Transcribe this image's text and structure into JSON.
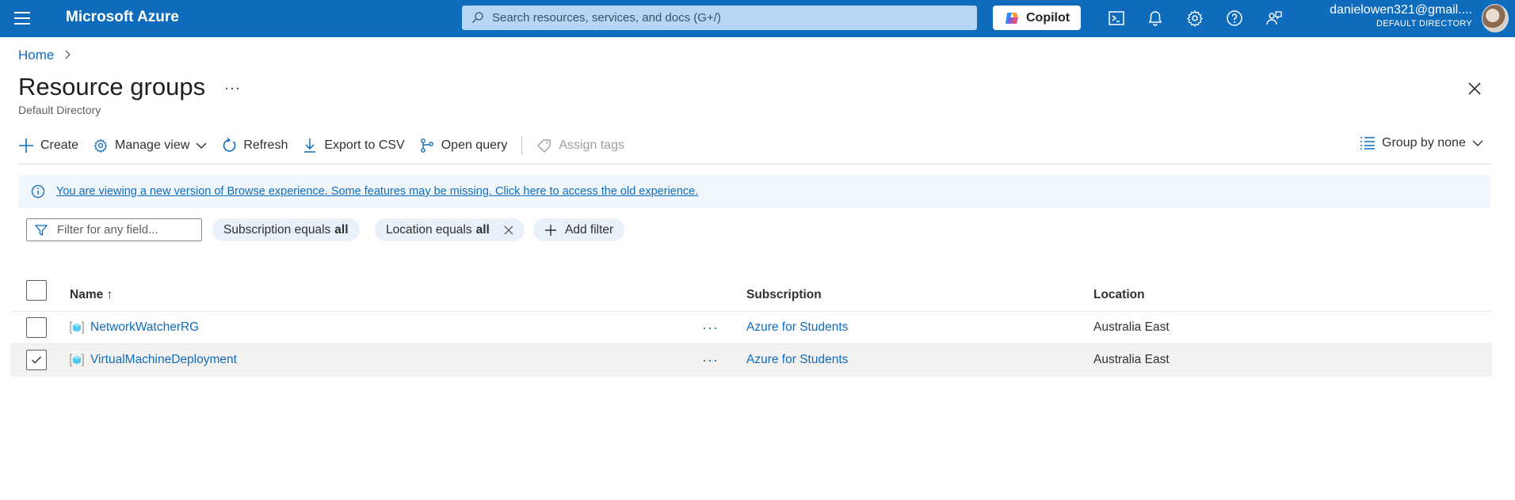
{
  "topbar": {
    "brand": "Microsoft Azure",
    "search_placeholder": "Search resources, services, and docs (G+/)",
    "copilot_label": "Copilot",
    "account_email": "danielowen321@gmail....",
    "account_directory": "DEFAULT DIRECTORY",
    "icons": [
      "cloud-shell-icon",
      "bell-icon",
      "gear-icon",
      "help-icon",
      "feedback-icon"
    ]
  },
  "breadcrumb": {
    "home": "Home"
  },
  "page": {
    "title": "Resource groups",
    "more": "···",
    "subtitle": "Default Directory"
  },
  "toolbar": {
    "create": "Create",
    "manage_view": "Manage view",
    "refresh": "Refresh",
    "export_csv": "Export to CSV",
    "open_query": "Open query",
    "assign_tags": "Assign tags",
    "group_by": "Group by none"
  },
  "banner": {
    "text": "You are viewing a new version of Browse experience. Some features may be missing. Click here to access the old experience."
  },
  "filters": {
    "placeholder": "Filter for any field...",
    "subscription_label": "Subscription equals",
    "subscription_value": "all",
    "location_label": "Location equals",
    "location_value": "all",
    "add_filter": "Add filter"
  },
  "table": {
    "columns": {
      "name": "Name ↑",
      "subscription": "Subscription",
      "location": "Location"
    },
    "rows": [
      {
        "name": "NetworkWatcherRG",
        "subscription": "Azure for Students",
        "location": "Australia East",
        "selected": false
      },
      {
        "name": "VirtualMachineDeployment",
        "subscription": "Azure for Students",
        "location": "Australia East",
        "selected": true
      }
    ],
    "row_more": "···"
  },
  "colors": {
    "topbar": "#0f6cbd",
    "link": "#0f6cbd",
    "banner_bg": "#eff6fc",
    "pill_bg": "#e8f0fa"
  }
}
